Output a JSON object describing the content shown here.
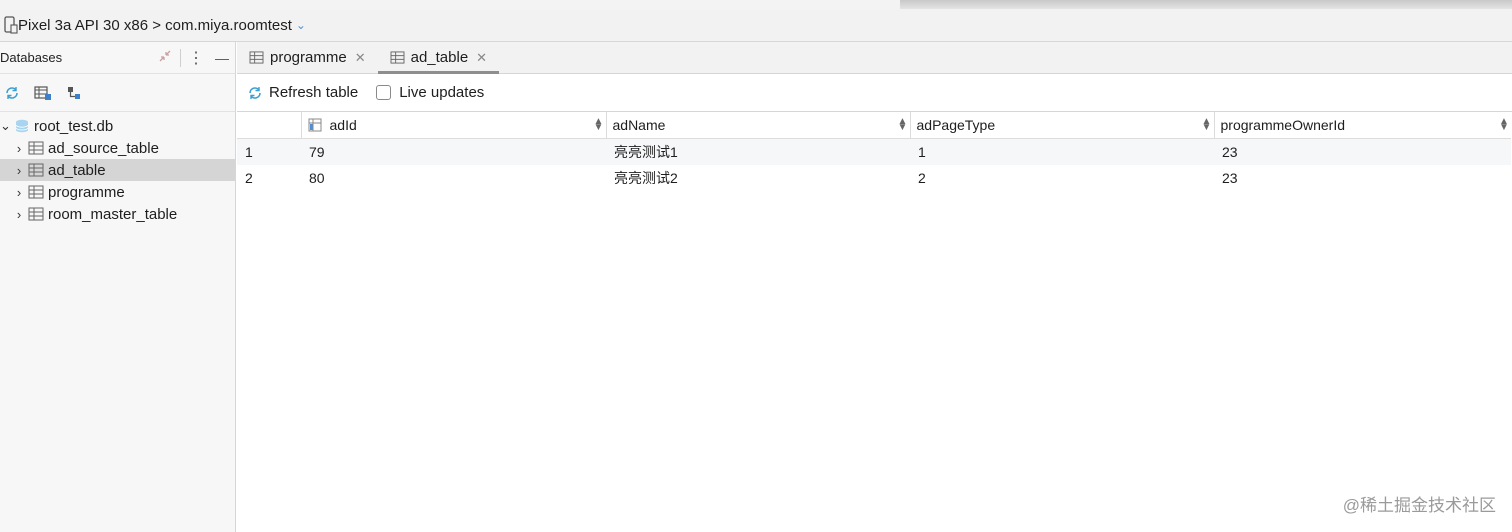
{
  "device": {
    "label": "Pixel 3a API 30 x86 > com.miya.roomtest"
  },
  "left_panel": {
    "title": "Databases",
    "tree": {
      "database": "root_test.db",
      "tables": [
        "ad_source_table",
        "ad_table",
        "programme",
        "room_master_table"
      ],
      "selected": "ad_table"
    }
  },
  "tabs": [
    {
      "label": "programme",
      "active": false
    },
    {
      "label": "ad_table",
      "active": true
    }
  ],
  "toolbar": {
    "refresh_label": "Refresh table",
    "live_label": "Live updates",
    "live_checked": false
  },
  "table": {
    "columns": [
      "adId",
      "adName",
      "adPageType",
      "programmeOwnerId"
    ],
    "rows": [
      {
        "index": "1",
        "cells": [
          "79",
          "亮亮测试1",
          "1",
          "23"
        ]
      },
      {
        "index": "2",
        "cells": [
          "80",
          "亮亮测试2",
          "2",
          "23"
        ]
      }
    ]
  },
  "watermark": "@稀土掘金技术社区",
  "colors": {
    "accent": "#4a8fd8",
    "selected_row": "#d5d5d5",
    "panel_bg": "#f7f7f7"
  }
}
